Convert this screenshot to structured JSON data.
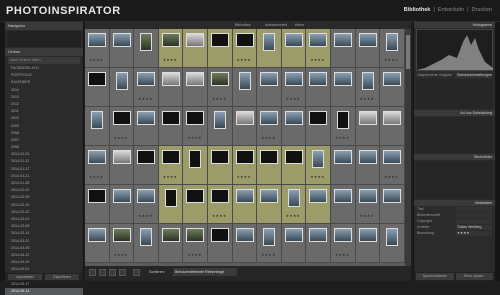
{
  "app": {
    "title": "PHOTOINSPIRATOR"
  },
  "modules": [
    {
      "label": "Bibliothek",
      "active": true
    },
    {
      "label": "|",
      "active": false
    },
    {
      "label": "Entwickeln",
      "active": false
    },
    {
      "label": "|",
      "active": false
    },
    {
      "label": "Drucken",
      "active": false
    }
  ],
  "left_panel": {
    "navigator": "Navigator",
    "folders_header": "Ordner",
    "search_placeholder": "Nach Ordnern filtern",
    "rows": [
      {
        "label": "FACEBOOK-KO1",
        "count": "",
        "sel": false
      },
      {
        "label": "PORTFOLIO",
        "count": "",
        "sel": false
      },
      {
        "label": "KALENDER",
        "count": "",
        "sel": false
      },
      {
        "label": "2014",
        "count": "",
        "sel": false
      },
      {
        "label": "2013",
        "count": "",
        "sel": false
      },
      {
        "label": "2012",
        "count": "",
        "sel": false
      },
      {
        "label": "2011",
        "count": "",
        "sel": false
      },
      {
        "label": "2010",
        "count": "",
        "sel": false
      },
      {
        "label": "2009",
        "count": "",
        "sel": false
      },
      {
        "label": "2008",
        "count": "",
        "sel": false
      },
      {
        "label": "2007",
        "count": "",
        "sel": false
      },
      {
        "label": "2006",
        "count": "",
        "sel": false
      },
      {
        "label": "2014-01-03",
        "count": "",
        "sel": false
      },
      {
        "label": "2014-01-11",
        "count": "",
        "sel": false
      },
      {
        "label": "2014-01-17",
        "count": "",
        "sel": false
      },
      {
        "label": "2014-01-21",
        "count": "",
        "sel": false
      },
      {
        "label": "2014-01-28",
        "count": "",
        "sel": false
      },
      {
        "label": "2014-02-02",
        "count": "",
        "sel": false
      },
      {
        "label": "2014-02-09",
        "count": "",
        "sel": false
      },
      {
        "label": "2014-02-15",
        "count": "",
        "sel": false
      },
      {
        "label": "2014-02-22",
        "count": "",
        "sel": false
      },
      {
        "label": "2014-03-01",
        "count": "",
        "sel": false
      },
      {
        "label": "2014-03-08",
        "count": "",
        "sel": false
      },
      {
        "label": "2014-03-14",
        "count": "",
        "sel": false
      },
      {
        "label": "2014-03-22",
        "count": "",
        "sel": false
      },
      {
        "label": "2014-04-05",
        "count": "",
        "sel": false
      },
      {
        "label": "2014-04-12",
        "count": "",
        "sel": false
      },
      {
        "label": "2014-04-19",
        "count": "",
        "sel": false
      },
      {
        "label": "2014-05-01",
        "count": "",
        "sel": false
      },
      {
        "label": "2014-05-10",
        "count": "",
        "sel": false
      },
      {
        "label": "2014-05-17",
        "count": "",
        "sel": false
      },
      {
        "label": "2014-06-13",
        "count": "",
        "sel": true
      }
    ],
    "import_button": "Importieren",
    "export_button": "Exportieren"
  },
  "grid": {
    "tabs": [
      "Bibliothek",
      "Aufnahmezeit",
      "Keine"
    ],
    "rows": [
      [
        "sky",
        "sky",
        "green",
        "green",
        "bright",
        "dark",
        "dark",
        "sky",
        "sky",
        "sky",
        "sky",
        "sky",
        "sky"
      ],
      [
        "dark",
        "sky",
        "sky",
        "bright",
        "bright",
        "green",
        "sky",
        "sky",
        "sky",
        "sky",
        "sky",
        "sky",
        "sky"
      ],
      [
        "sky",
        "dark",
        "sky",
        "dark",
        "dark",
        "sky",
        "bright",
        "sky",
        "sky",
        "dark",
        "dark",
        "bright",
        "bright"
      ],
      [
        "sky",
        "bright",
        "dark",
        "dark",
        "dark",
        "dark",
        "dark",
        "dark",
        "dark",
        "sky",
        "sky",
        "sky",
        "sky"
      ],
      [
        "dark",
        "sky",
        "sky",
        "dark",
        "dark",
        "dark",
        "sky",
        "sky",
        "sky",
        "sky",
        "sky",
        "sky",
        "sky"
      ],
      [
        "sky",
        "green",
        "sky",
        "green",
        "green",
        "dark",
        "sky",
        "sky",
        "sky",
        "sky",
        "sky",
        "sky",
        "sky"
      ]
    ],
    "selected_rows": [
      0,
      3,
      4
    ],
    "stars": "★★★★"
  },
  "toolbar": {
    "sort_label": "Sortieren:",
    "sort_value": "Benutzerdefinierte Reihenfolge"
  },
  "right_panel": {
    "histogram": "Histogramm",
    "quick_develop": "Ad-hoc-Entwicklung",
    "saved_preset_label": "Gespeicherte Vorgabe",
    "saved_preset_value": "Standardeinstellungen",
    "keywords": "Stichwörter",
    "metadata": "Metadaten",
    "fields": [
      {
        "k": "Titel",
        "v": ""
      },
      {
        "k": "Bildunterschrift",
        "v": ""
      },
      {
        "k": "Copyright",
        "v": ""
      },
      {
        "k": "Urheber",
        "v": "Tobias Weilbieg"
      },
      {
        "k": "Bewertung",
        "v": "★★★★"
      }
    ],
    "sync_button": "Synchronisieren",
    "sync_settings_button": "Einst. synchr."
  },
  "colors": {
    "accent": "#9b9c6a",
    "panel": "#2b2b2b",
    "grid": "#5d5d5d"
  }
}
